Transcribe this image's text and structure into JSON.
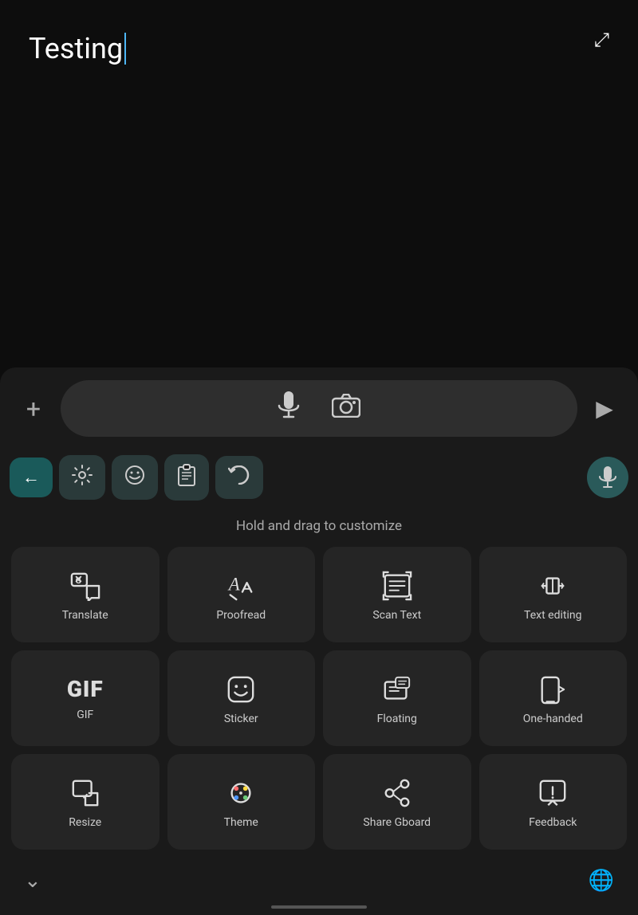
{
  "textArea": {
    "content": "Testing",
    "expandIcon": "⤢"
  },
  "inputRow": {
    "plusIcon": "+",
    "sendIcon": "▶"
  },
  "toolbar": {
    "backIcon": "←",
    "settingsIcon": "⚙",
    "emojiIcon": "🙂",
    "clipboardIcon": "📋",
    "undoIcon": "↩"
  },
  "holdDragText": "Hold and drag to customize",
  "gridItems": [
    {
      "id": "translate",
      "label": "Translate"
    },
    {
      "id": "proofread",
      "label": "Proofread"
    },
    {
      "id": "scan-text",
      "label": "Scan Text"
    },
    {
      "id": "text-editing",
      "label": "Text editing"
    },
    {
      "id": "gif",
      "label": "GIF"
    },
    {
      "id": "sticker",
      "label": "Sticker"
    },
    {
      "id": "floating",
      "label": "Floating"
    },
    {
      "id": "one-handed",
      "label": "One-handed"
    },
    {
      "id": "resize",
      "label": "Resize"
    },
    {
      "id": "theme",
      "label": "Theme"
    },
    {
      "id": "share-gboard",
      "label": "Share Gboard"
    },
    {
      "id": "feedback",
      "label": "Feedback"
    }
  ],
  "bottomBar": {
    "chevron": "⌄",
    "globe": "🌐"
  }
}
